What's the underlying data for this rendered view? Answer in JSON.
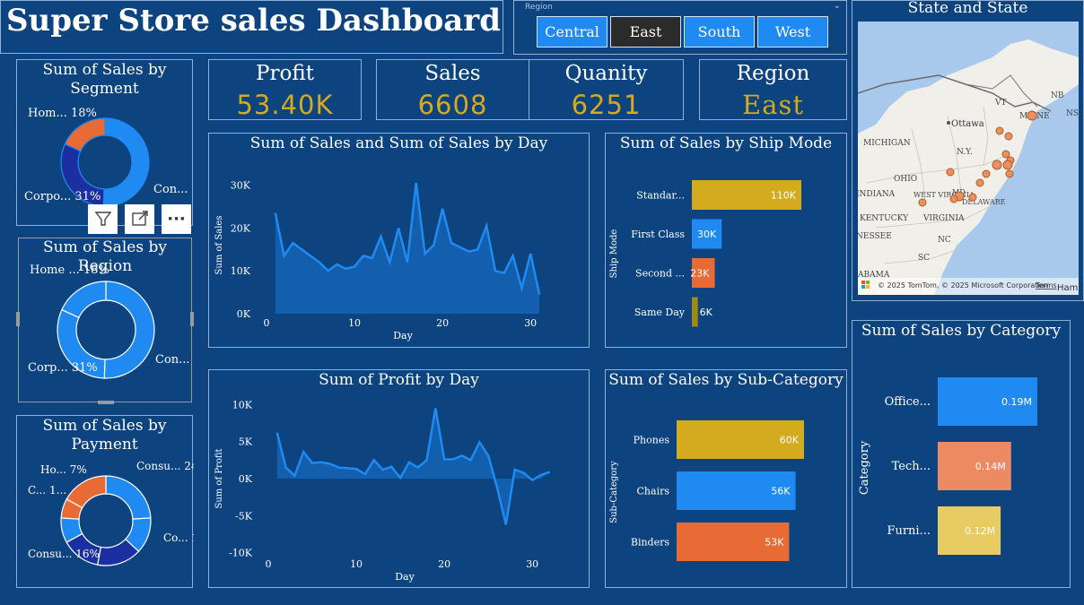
{
  "title": "Super Store sales Dashboard",
  "region_slicer": {
    "label": "Region",
    "options": [
      "Central",
      "East",
      "South",
      "West"
    ],
    "selected": "East"
  },
  "kpis": [
    {
      "label": "Profit",
      "value": "53.40K"
    },
    {
      "label": "Sales",
      "value": "6608"
    },
    {
      "label": "Quanity",
      "value": "6251"
    },
    {
      "label": "Region",
      "value": "East"
    }
  ],
  "segment_chart": {
    "title": "Sum of Sales by Segment",
    "labels": [
      "Hom... 18%",
      "Corpo... 31%",
      "Con... 50%"
    ]
  },
  "region_chart": {
    "title": "Sum of Sales by Region",
    "labels": [
      "Home ... 18%",
      "Corp... 31%",
      "Con... 50%"
    ]
  },
  "payment_chart": {
    "title": "Sum of Sales by Payment",
    "labels": [
      "Consu... 24%",
      "Ho... 7%",
      "C... 1...",
      "Co... 1...",
      "Consu... 16%"
    ]
  },
  "visual_toolbar": {
    "filter": "filter-icon",
    "focus": "focus-mode-icon",
    "more": "more-options-icon"
  },
  "map": {
    "title": "State and State",
    "copyright": "© 2025 TomTom, © 2025 Microsoft Corporation",
    "terms": "Terms",
    "logo_text": "Microsoft Bing",
    "places": [
      "Ottawa",
      "MICHIGAN",
      "N.Y.",
      "OHIO",
      "WEST VIRGINIA",
      "VIRGINIA",
      "KENTUCKY",
      "NC",
      "SC",
      "NB",
      "NS",
      "VT",
      "MAINE",
      "DELAWARE",
      "MD",
      "INDIANA",
      "NESSEE",
      "ABAMA",
      "Hamil"
    ]
  },
  "colors": {
    "background": "#0d4480",
    "gold": "#d4aa1e",
    "blue": "#1f8bf2",
    "orange": "#e86b36",
    "dark_blue": "#1b2fa0",
    "light_orange": "#ec8a63",
    "yellow": "#e7cc63",
    "area_fill": "#1560b0"
  },
  "chart_data": [
    {
      "type": "area",
      "title": "Sum of Sales and Sum of Sales by Day",
      "xlabel": "Day",
      "ylabel": "Sum of Sales",
      "x": [
        1,
        2,
        3,
        4,
        5,
        6,
        7,
        8,
        9,
        10,
        11,
        12,
        13,
        14,
        15,
        16,
        17,
        18,
        19,
        20,
        21,
        22,
        23,
        24,
        25,
        26,
        27,
        28,
        29,
        30,
        31
      ],
      "values": [
        23500,
        13500,
        16500,
        15000,
        13500,
        12000,
        10000,
        11500,
        10500,
        11000,
        13500,
        13000,
        18000,
        12000,
        20000,
        12000,
        30500,
        14000,
        16000,
        24500,
        16500,
        15500,
        14500,
        15000,
        20500,
        10000,
        9500,
        13500,
        6000,
        14000,
        4500
      ],
      "xticks": [
        0,
        10,
        20,
        30
      ],
      "yticks": [
        "0K",
        "10K",
        "20K",
        "30K"
      ],
      "ylim": [
        0,
        32000
      ],
      "xlim": [
        0,
        31
      ]
    },
    {
      "type": "area",
      "title": "Sum of Profit by Day",
      "xlabel": "Day",
      "ylabel": "Sum of Profit",
      "x": [
        1,
        2,
        3,
        4,
        5,
        6,
        7,
        8,
        9,
        10,
        11,
        12,
        13,
        14,
        15,
        16,
        17,
        18,
        19,
        20,
        21,
        22,
        23,
        24,
        25,
        26,
        27,
        28,
        29,
        30,
        31
      ],
      "values": [
        6200,
        1500,
        400,
        3600,
        2100,
        2200,
        2000,
        1500,
        1400,
        1300,
        600,
        2500,
        1200,
        1600,
        100,
        2200,
        1500,
        2500,
        9500,
        2600,
        2600,
        3100,
        2500,
        4900,
        3100,
        -1200,
        -6200,
        1200,
        800,
        -200,
        500,
        900
      ],
      "xticks": [
        0,
        10,
        20,
        30
      ],
      "yticks": [
        "-10K",
        "-5K",
        "0K",
        "5K",
        "10K"
      ],
      "ylim": [
        -11000,
        11000
      ],
      "xlim": [
        0,
        31
      ]
    },
    {
      "type": "bar",
      "title": "Sum of Sales by Ship Mode",
      "ylabel": "Ship Mode",
      "categories": [
        "Standar...",
        "First Class",
        "Second ...",
        "Same Day"
      ],
      "values": [
        110000,
        30000,
        23000,
        6000
      ],
      "data_labels": [
        "110K",
        "30K",
        "23K",
        "6K"
      ],
      "colors": [
        "#d4aa1e",
        "#1f8bf2",
        "#e86b36",
        "#a08a10"
      ]
    },
    {
      "type": "bar",
      "title": "Sum of Sales by Sub-Category",
      "ylabel": "Sub-Category",
      "categories": [
        "Phones",
        "Chairs",
        "Binders"
      ],
      "values": [
        60000,
        56000,
        53000
      ],
      "data_labels": [
        "60K",
        "56K",
        "53K"
      ],
      "colors": [
        "#d4aa1e",
        "#1f8bf2",
        "#e86b36"
      ]
    },
    {
      "type": "bar",
      "title": "Sum of Sales by Category",
      "ylabel": "Category",
      "categories": [
        "Office...",
        "Tech...",
        "Furni..."
      ],
      "values": [
        190000,
        140000,
        120000
      ],
      "data_labels": [
        "0.19M",
        "0.14M",
        "0.12M"
      ],
      "colors": [
        "#1f8bf2",
        "#ec8a63",
        "#e7cc63"
      ]
    },
    {
      "type": "pie",
      "title": "Sum of Sales by Segment",
      "categories": [
        "Consumer",
        "Corporate",
        "Home Office"
      ],
      "values": [
        50,
        31,
        18
      ],
      "colors": [
        "#1f8bf2",
        "#1b2fa0",
        "#e86b36"
      ]
    },
    {
      "type": "pie",
      "title": "Sum of Sales by Region",
      "categories": [
        "Consumer",
        "Corporate",
        "Home Office"
      ],
      "values": [
        50,
        31,
        18
      ],
      "colors": [
        "#1f8bf2",
        "#1f8bf2",
        "#1f8bf2"
      ]
    },
    {
      "type": "pie",
      "title": "Sum of Sales by Payment",
      "categories": [
        "Consumer",
        "Consumer",
        "Consumer",
        "Corporate",
        "Corporate",
        "Home Office",
        "Home Office"
      ],
      "values": [
        24,
        13,
        16,
        14,
        9,
        7,
        17
      ],
      "colors": [
        "#1f8bf2",
        "#1f8bf2",
        "#1b2fa0",
        "#1b2fa0",
        "#1f8bf2",
        "#e86b36",
        "#e86b36"
      ]
    }
  ]
}
